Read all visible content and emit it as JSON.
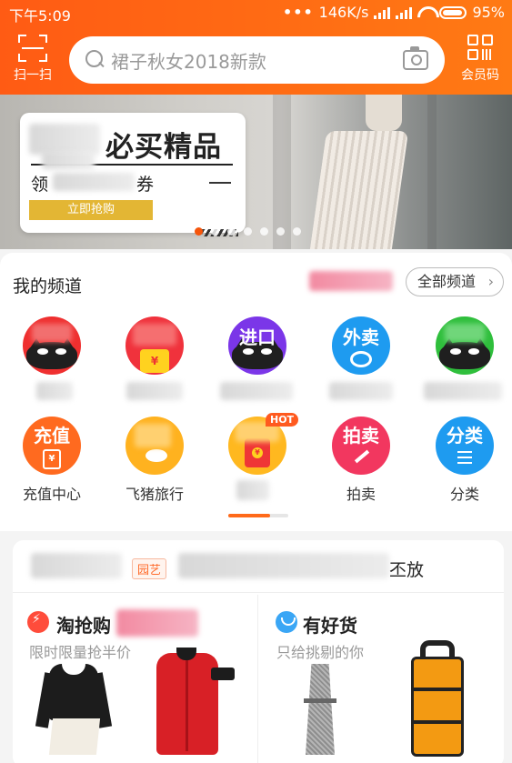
{
  "status": {
    "time": "下午5:09",
    "net_speed": "146K/s",
    "battery": "95%"
  },
  "header": {
    "scan_label": "扫一扫",
    "member_label": "会员码",
    "search_placeholder": "裙子秋女2018新款"
  },
  "banner": {
    "title": "必买精品",
    "subtitle": "领",
    "subtitle_suffix": "券",
    "button": "立即抢购",
    "page_count": 7,
    "active_page": 0
  },
  "channels": {
    "title": "我的频道",
    "all_button": "全部频道",
    "items": [
      {
        "label": "",
        "icon": "tmall-cat-icon",
        "color": "#ef2f2f",
        "text": ""
      },
      {
        "label": "",
        "icon": "tmall-gift-icon",
        "color": "#f0323c",
        "text": ""
      },
      {
        "label": "",
        "icon": "import-icon",
        "color": "#7b36e8",
        "text": "进口"
      },
      {
        "label": "",
        "icon": "takeout-icon",
        "color": "#1e9bf0",
        "text": "外卖"
      },
      {
        "label": "",
        "icon": "tmall-green-icon",
        "color": "#2fbf3c",
        "text": ""
      },
      {
        "label": "充值中心",
        "icon": "recharge-icon",
        "color": "#ff6a1f",
        "text": "充值"
      },
      {
        "label": "飞猪旅行",
        "icon": "fliggy-icon",
        "color": "#ffb21f",
        "text": ""
      },
      {
        "label": "",
        "icon": "red-envelope-icon",
        "color": "#ffb81f",
        "text": "",
        "badge": "HOT"
      },
      {
        "label": "拍卖",
        "icon": "auction-icon",
        "color": "#f2375f",
        "text": "拍卖"
      },
      {
        "label": "分类",
        "icon": "category-icon",
        "color": "#1e9bf0",
        "text": "分类"
      }
    ]
  },
  "news": {
    "tag": "园艺",
    "text_end": "丕放"
  },
  "sections": {
    "left": {
      "title": "淘抢购",
      "subtitle": "限时限量抢半价"
    },
    "right": {
      "title": "有好货",
      "subtitle": "只给挑剔的你"
    }
  }
}
